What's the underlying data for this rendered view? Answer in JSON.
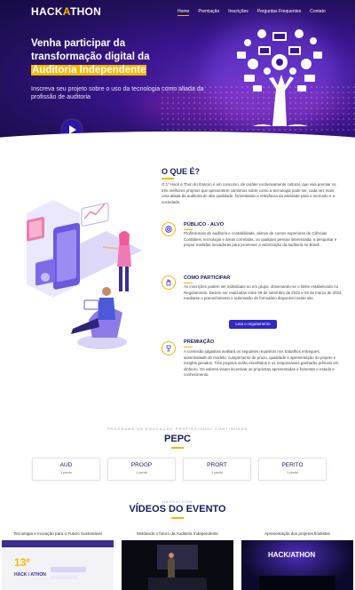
{
  "header": {
    "logo_left": "HACK",
    "logo_accent": "A",
    "logo_right": "THON",
    "nav": [
      "Home",
      "Premiação",
      "Inscrições",
      "Perguntas Frequentes",
      "Contato"
    ],
    "active_nav": "Home"
  },
  "hero": {
    "title_line1": "Venha participar da",
    "title_line2": "transformação digital da",
    "title_highlight": "Auditoria Independente",
    "subtitle": "Inscreva seu projeto sobre o uso da tecnologia como aliada da profissão de auditoria"
  },
  "about": {
    "title": "O QUE É?",
    "text": "O 1º Hack a Thon do Ibracon é um concurso, de caráter exclusivamente cultural, que visa premiar os três melhores projetos que apresentem caminhos sobre como a tecnologia pode ser, cada vez mais, uma aliada da auditoria de alta qualidade, fomentando a relevância da atividade para o mercado e a sociedade."
  },
  "features": [
    {
      "title": "PÚBLICO - ALVO",
      "text": "Profissionais de auditoria e contabilidade, alunos de cursos superiores de Ciências Contábeis, tecnologia e áreas correlatas, ou qualquer pessoa interessada, a pesquisar e propor medidas inovadoras para promover a valorização da auditoria no Brasil.",
      "icon": "target-icon"
    },
    {
      "title": "COMO PARTICIPAR",
      "text": "As inscrições podem ser individuais ou em grupo, observando-se o limite estabelecido no Regulamento. Devem ser realizadas entre 09 de setembro de 2022 e 03 de março de 2023, mediante o preenchimento e submissão do formulário disponível neste site.",
      "icon": "hand-icon",
      "button": "Leia o regulamento"
    },
    {
      "title": "PREMIAÇÃO",
      "text": "A comissão julgadora avaliará os seguintes requisitos nos trabalhos entregues: assertividade do modelo, cumprimento de prazo, qualidade e apresentação do projeto e insights gerados. Três projetos serão escolhidos e os responsáveis ganharão prêmios em dinheiro. Os valores visam incentivar as propostas apresentadas e fomentar o estudo e conhecimento.",
      "icon": "trophy-icon"
    }
  ],
  "pepc": {
    "overline": "PROGRAMA DE EDUCAÇÃO PROFISSIONAL CONTINUADA",
    "title": "PEPC",
    "cards": [
      {
        "title": "AUD",
        "sub": "1 ponto"
      },
      {
        "title": "PROGP",
        "sub": "1 ponto"
      },
      {
        "title": "PRORT",
        "sub": "1 ponto"
      },
      {
        "title": "PERITO",
        "sub": "1 ponto"
      }
    ]
  },
  "videos": {
    "overline": "HACKATHON",
    "title": "VÍDEOS DO EVENTO",
    "items": [
      {
        "title": "Tecnologia e Inovação para o Futuro Sustentável",
        "thumb_text": "13º",
        "thumb_sub": "HACK / ATHON"
      },
      {
        "title": "Moldando o futuro da Auditoria Independente",
        "thumb_text": "",
        "thumb_sub": ""
      },
      {
        "title": "Apresentação dos projetos finalistas",
        "thumb_text": "HACK/ATHON",
        "thumb_sub": ""
      }
    ]
  },
  "colors": {
    "brand_dark": "#1a1a5e",
    "accent": "#f5b700",
    "hero_bg": "#2a1478",
    "button": "#2f28c8"
  }
}
